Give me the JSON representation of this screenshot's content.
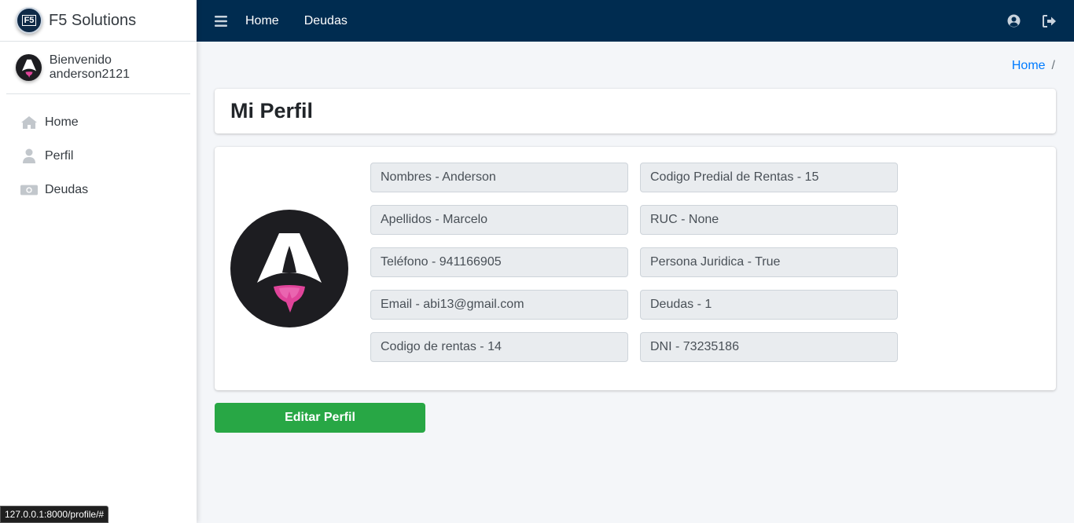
{
  "brand": {
    "name": "F5 Solutions",
    "logo_text": "F5"
  },
  "user": {
    "welcome": "Bienvenido anderson2121"
  },
  "sidebar": {
    "items": [
      {
        "label": "Home",
        "icon": "home-icon"
      },
      {
        "label": "Perfil",
        "icon": "user-icon"
      },
      {
        "label": "Deudas",
        "icon": "money-icon"
      }
    ]
  },
  "topbar": {
    "links": [
      "Home",
      "Deudas"
    ],
    "icons": [
      "user-circle-icon",
      "sign-out-icon"
    ]
  },
  "breadcrumb": {
    "home": "Home",
    "separator": "/"
  },
  "page": {
    "title": "Mi Perfil"
  },
  "profile": {
    "left": [
      "Nombres - Anderson",
      "Apellidos - Marcelo",
      "Teléfono - 941166905",
      "Email - abi13@gmail.com",
      "Codigo de rentas - 14"
    ],
    "right": [
      "Codigo Predial de Rentas - 15",
      "RUC - None",
      "Persona Juridica - True",
      "Deudas - 1",
      "DNI - 73235186"
    ]
  },
  "actions": {
    "edit": "Editar Perfil"
  },
  "status": {
    "url": "127.0.0.1:8000/profile/#"
  },
  "colors": {
    "topbar": "#002c50",
    "accent": "#007bff",
    "success": "#28a745",
    "avatar_bg": "#1d1d21",
    "avatar_flame": "#e0449a"
  }
}
